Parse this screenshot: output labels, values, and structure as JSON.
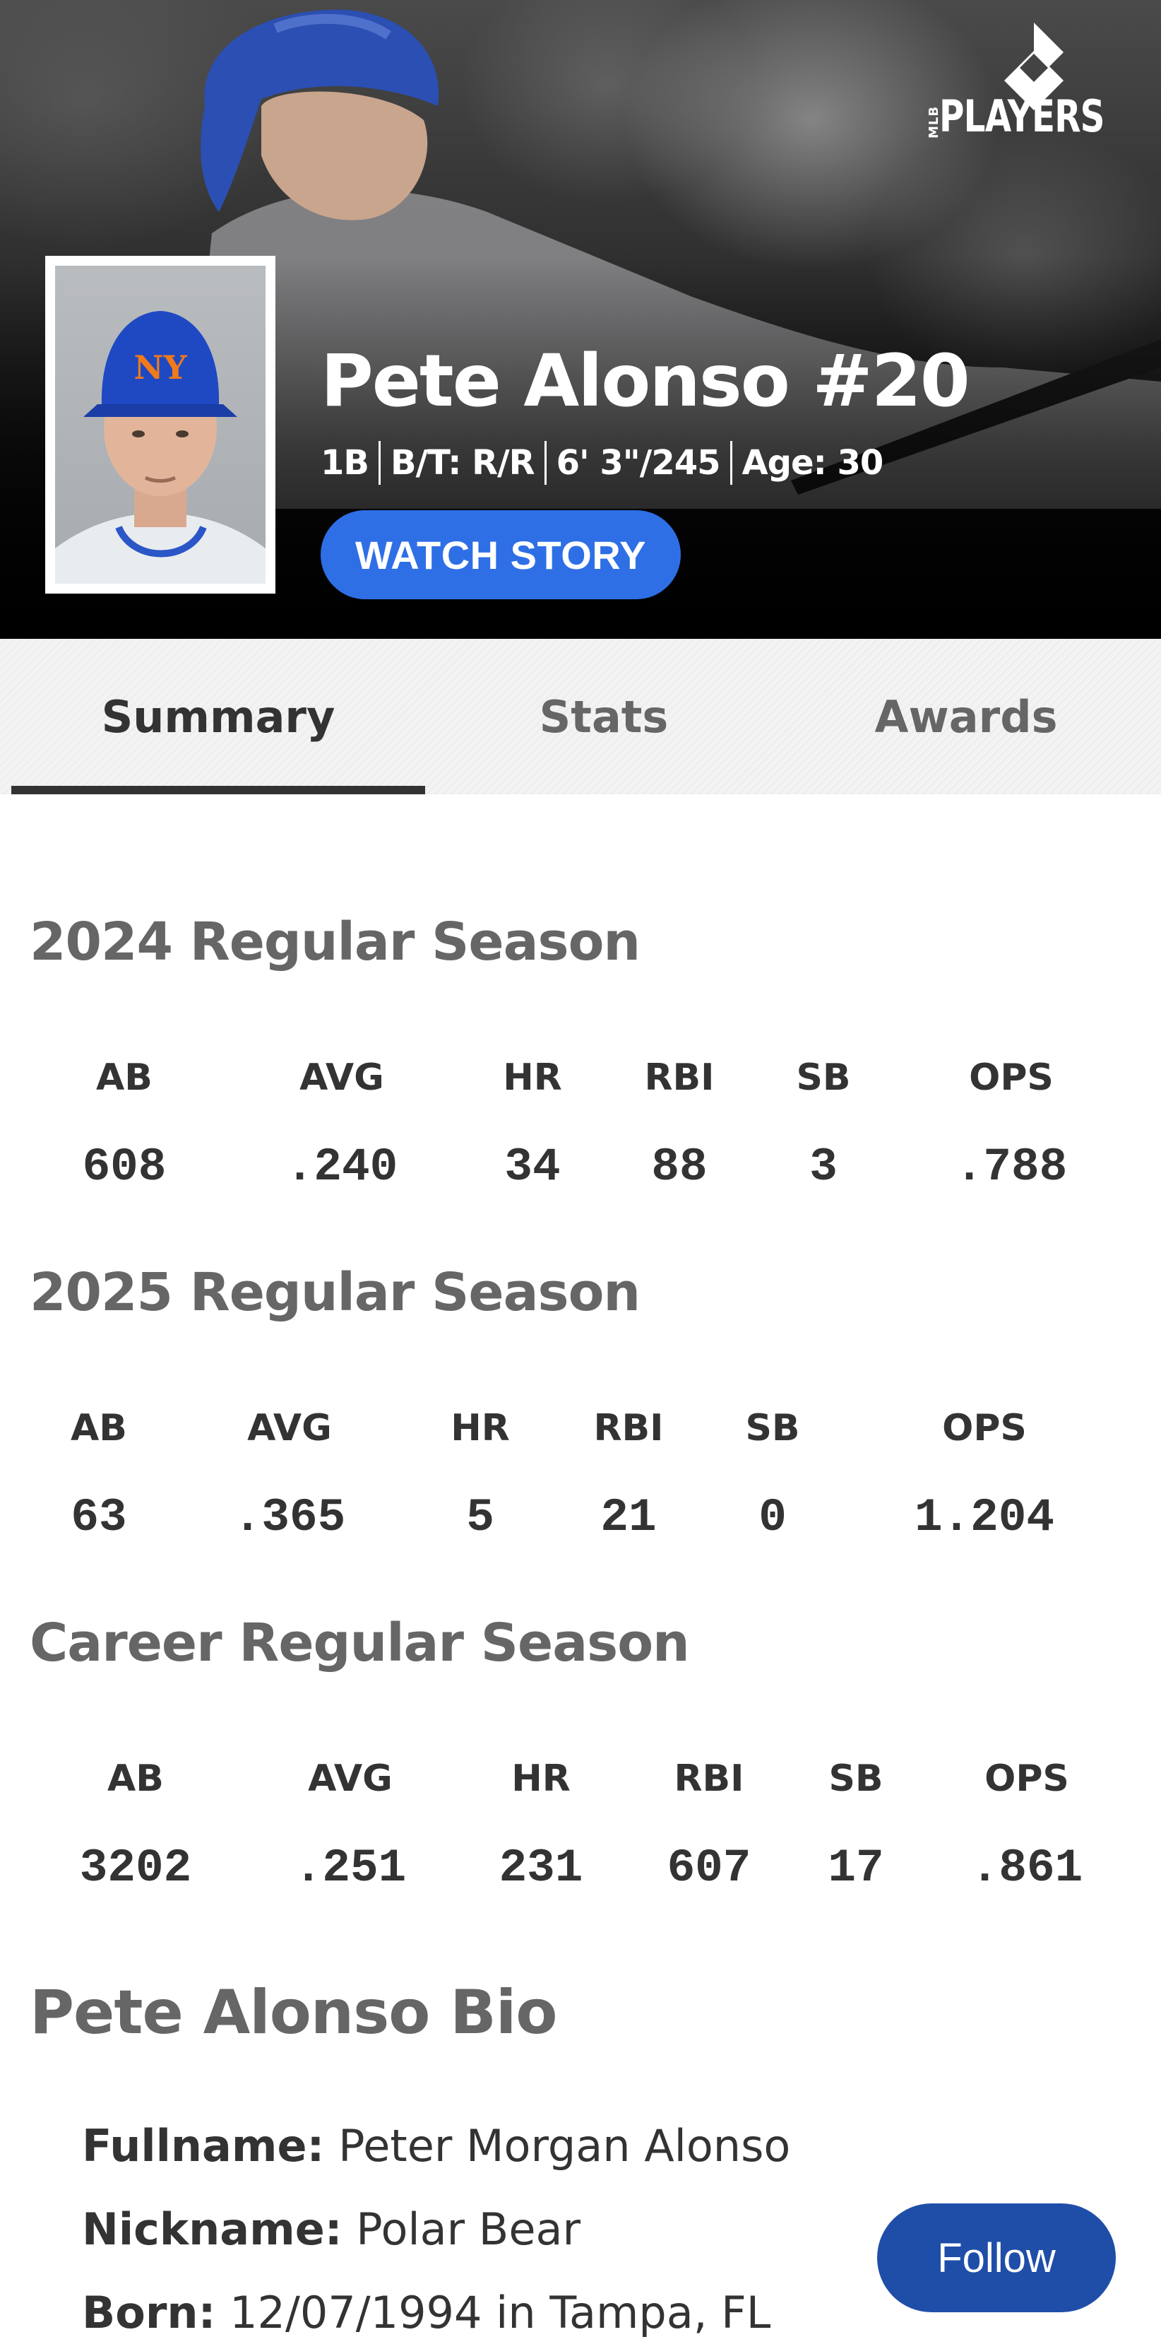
{
  "header": {
    "logo_text": "PLAYERS",
    "logo_mlb": "MLB",
    "player_name": "Pete Alonso #20",
    "position": "1B",
    "bats_throws": "B/T: R/R",
    "height_weight": "6' 3\"/245",
    "age": "Age: 30",
    "watch_story_label": "WATCH STORY",
    "watch_story_color": "#2e6fe6"
  },
  "tabs": [
    {
      "label": "Summary",
      "active": true
    },
    {
      "label": "Stats",
      "active": false
    },
    {
      "label": "Awards",
      "active": false
    }
  ],
  "seasons": [
    {
      "title": "2024 Regular Season",
      "stats": [
        {
          "label": "AB",
          "value": "608"
        },
        {
          "label": "AVG",
          "value": ".240"
        },
        {
          "label": "HR",
          "value": "34"
        },
        {
          "label": "RBI",
          "value": "88"
        },
        {
          "label": "SB",
          "value": "3"
        },
        {
          "label": "OPS",
          "value": ".788"
        }
      ]
    },
    {
      "title": "2025 Regular Season",
      "stats": [
        {
          "label": "AB",
          "value": "63"
        },
        {
          "label": "AVG",
          "value": ".365"
        },
        {
          "label": "HR",
          "value": "5"
        },
        {
          "label": "RBI",
          "value": "21"
        },
        {
          "label": "SB",
          "value": "0"
        },
        {
          "label": "OPS",
          "value": "1.204"
        }
      ]
    },
    {
      "title": "Career Regular Season",
      "stats": [
        {
          "label": "AB",
          "value": "3202"
        },
        {
          "label": "AVG",
          "value": ".251"
        },
        {
          "label": "HR",
          "value": "231"
        },
        {
          "label": "RBI",
          "value": "607"
        },
        {
          "label": "SB",
          "value": "17"
        },
        {
          "label": "OPS",
          "value": ".861"
        }
      ]
    }
  ],
  "bio": {
    "title": "Pete Alonso Bio",
    "fullname_label": "Fullname:",
    "fullname": "Peter Morgan Alonso",
    "nickname_label": "Nickname:",
    "nickname": "Polar Bear",
    "born_label": "Born:",
    "born": "12/07/1994 in Tampa, FL",
    "follow_label": "Follow",
    "follow_color": "#1f4ea8"
  }
}
